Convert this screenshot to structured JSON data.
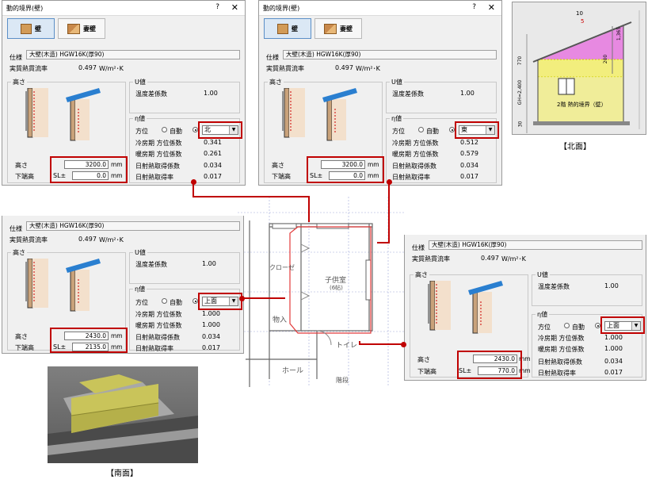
{
  "dialog": {
    "title": "動的境界(壁)",
    "help": "?",
    "close": "✕",
    "mode_wall": "壁",
    "mode_gable": "妻壁"
  },
  "labels": {
    "spec": "仕様",
    "flux": "実質熱貫流率",
    "height_group": "高さ",
    "u_group": "U値",
    "temp_coef": "温度差係数",
    "eta_group": "η値",
    "direction": "方位",
    "auto": "自動",
    "cool_coef": "冷房期 方位係数",
    "heat_coef": "暖房期 方位係数",
    "solar_coef": "日射熱取得係数",
    "solar_rate": "日射熱取得率",
    "height": "高さ",
    "bottom": "下端高",
    "sl": "SL±",
    "mm": "mm"
  },
  "common": {
    "spec_value": "大壁(木造) HGW16K(厚90)",
    "flux_value": "0.497",
    "flux_unit": "W/m²･K",
    "temp_coef_value": "1.00",
    "solar_coef_value": "0.034",
    "solar_rate_value": "0.017"
  },
  "d1": {
    "direction": "北",
    "cool": "0.341",
    "heat": "0.261",
    "height": "3200.0",
    "bottom": "0.0"
  },
  "d2": {
    "direction": "東",
    "cool": "0.512",
    "heat": "0.579",
    "height": "3200.0",
    "bottom": "0.0"
  },
  "d3": {
    "direction": "上面",
    "cool": "1.000",
    "heat": "1.000",
    "height": "2430.0",
    "bottom": "2135.0"
  },
  "d4": {
    "direction": "上面",
    "cool": "1.000",
    "heat": "1.000",
    "height": "2430.0",
    "bottom": "770.0"
  },
  "elevation": {
    "label": "2階 熱的境界（壁）",
    "dims": [
      "10",
      "5",
      "1,365",
      "200",
      "770",
      "GH=2,400",
      "30"
    ],
    "caption": "【北面】"
  },
  "plan": {
    "room": "子供室",
    "room_sub": "(6帖)",
    "closet": "クローゼ",
    "storage": "物入",
    "toilet": "トイレ",
    "hall": "ホール",
    "stairs": "階段"
  },
  "render": {
    "caption": "【南面】"
  },
  "colors": {
    "highlight": "#c00000",
    "pink": "#e77ee0",
    "yellow": "#f2ee7d",
    "wall_3d": "#c9c45a"
  }
}
